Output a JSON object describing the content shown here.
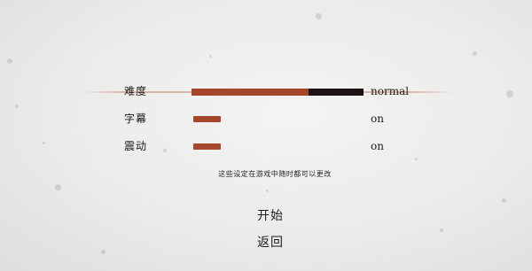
{
  "settings": {
    "difficulty": {
      "label": "难度",
      "value": "normal",
      "level": 0.68
    },
    "subtitles": {
      "label": "字幕",
      "value": "on",
      "enabled": true
    },
    "vibration": {
      "label": "震动",
      "value": "on",
      "enabled": true
    }
  },
  "notice": "这些设定在游戏中随时都可以更改",
  "menu": {
    "start_label": "开始",
    "back_label": "返回"
  },
  "colors": {
    "accent": "#a6462c",
    "track": "#1c1413",
    "text": "#1f1b19",
    "background": "#ebebea"
  }
}
